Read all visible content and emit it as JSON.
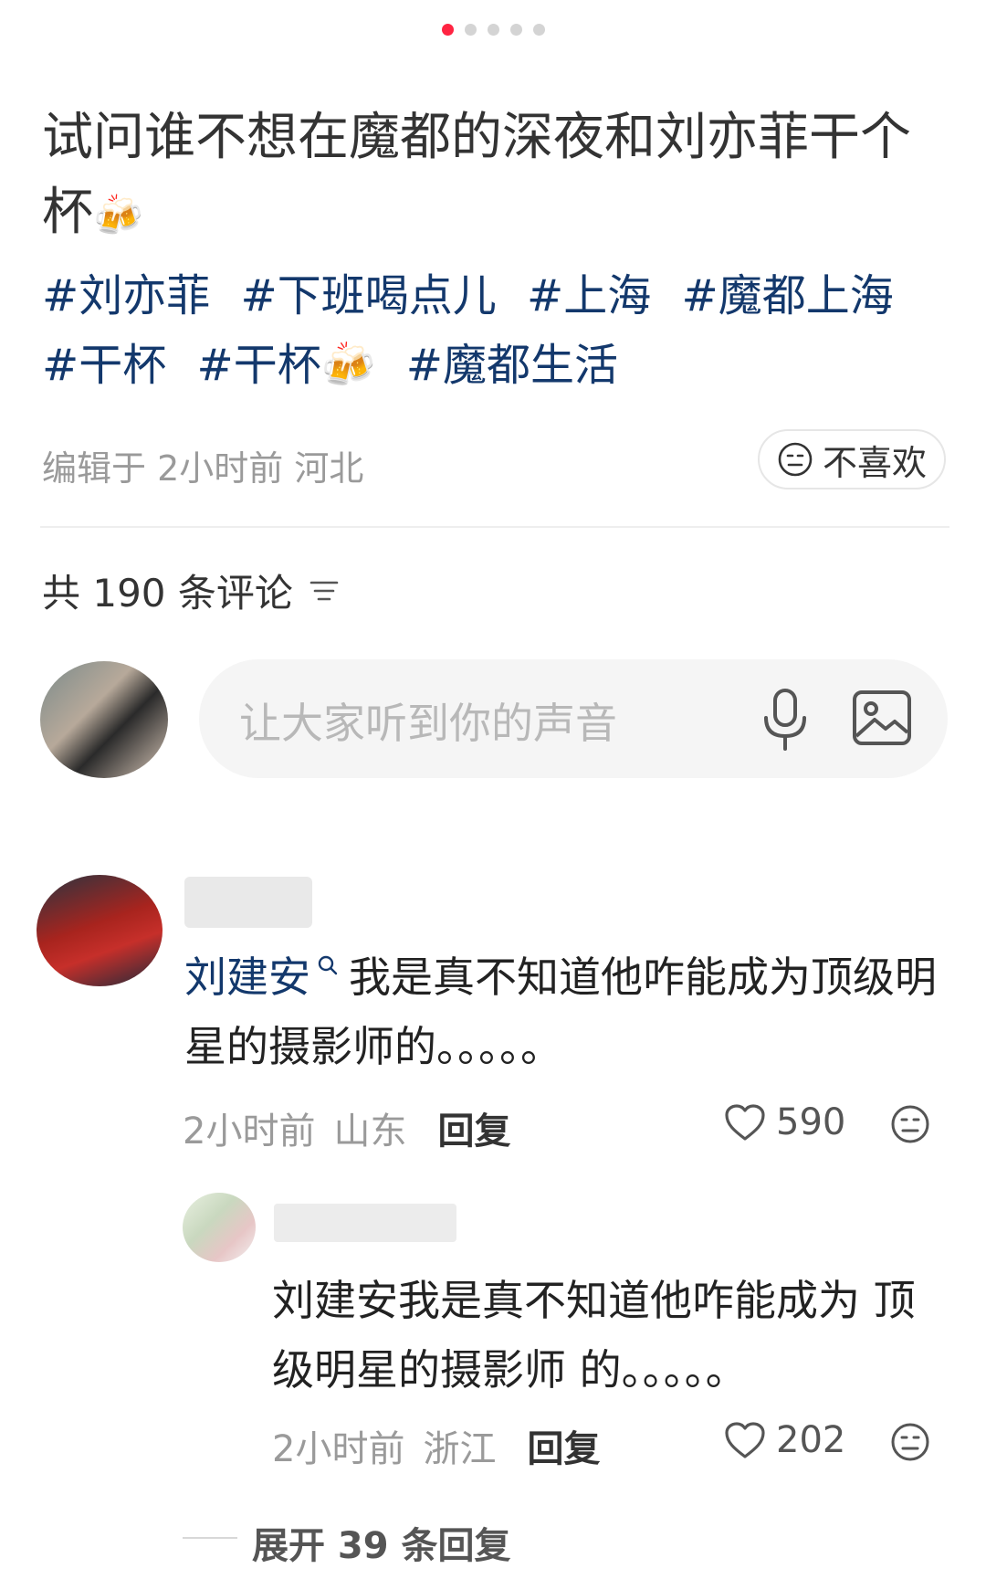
{
  "pager": {
    "count": 5,
    "active_index": 0
  },
  "post": {
    "title": "试问谁不想在魔都的深夜和刘亦菲干个杯",
    "title_emoji": "🍻",
    "tags": [
      "#刘亦菲",
      "#下班喝点儿",
      "#上海",
      "#魔都上海",
      "#干杯",
      "#干杯🍻",
      "#魔都生活"
    ],
    "meta": "编辑于 2小时前 河北",
    "dislike_label": "不喜欢"
  },
  "comments_header": {
    "count_text": "共 190 条评论"
  },
  "composer": {
    "placeholder": "让大家听到你的声音"
  },
  "comments": [
    {
      "mention": "刘建安",
      "text": "我是真不知道他咋能成为顶级明星的摄影师的。。。。。",
      "time": "2小时前",
      "location": "山东",
      "reply_label": "回复",
      "likes": "590"
    },
    {
      "text": "刘建安我是真不知道他咋能成为 顶级明星的摄影师 的。。。。。",
      "time": "2小时前",
      "location": "浙江",
      "reply_label": "回复",
      "likes": "202"
    }
  ],
  "expand_replies": "展开 39 条回复",
  "colors": {
    "accent": "#ff2442",
    "tag": "#13386c",
    "meta": "#9a9a9a"
  }
}
